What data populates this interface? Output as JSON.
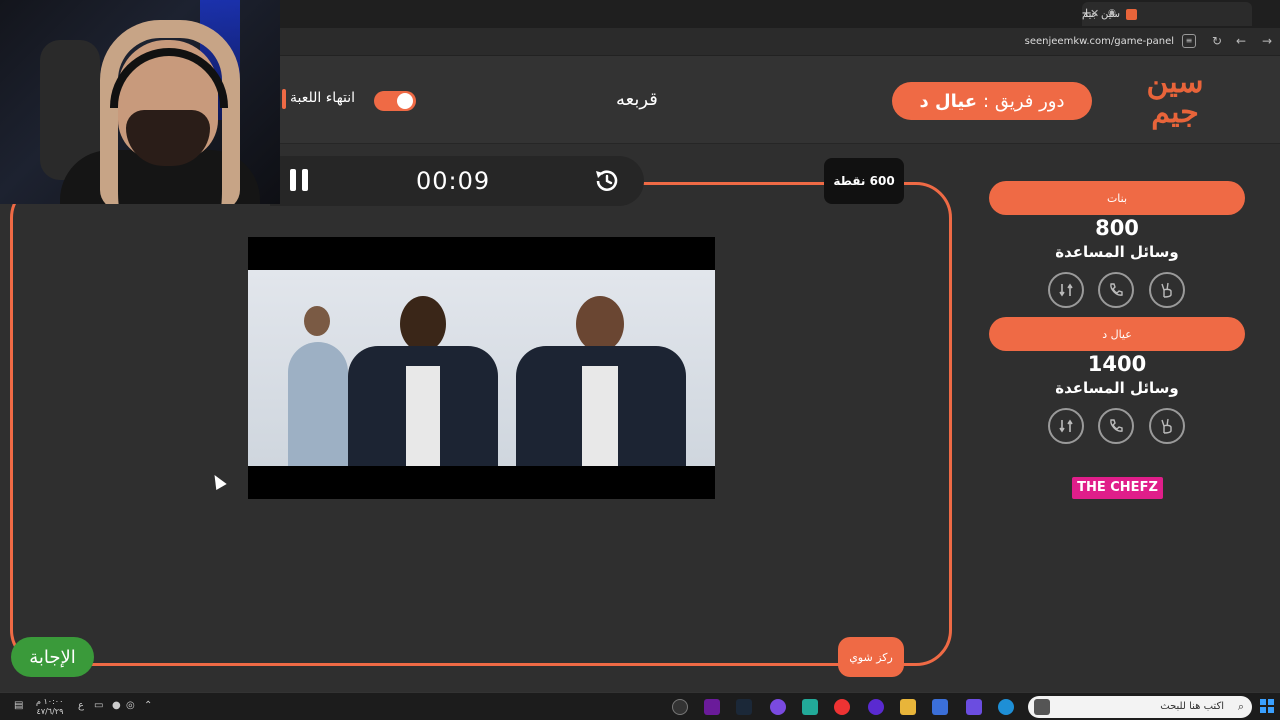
{
  "browser": {
    "tab_title": "سين جيم",
    "url": "seenjeemkw.com/game-panel",
    "new_tab_label": "+"
  },
  "header": {
    "logo_text": "سين جيم",
    "turn_label": "دور فريق :",
    "turn_team": "عيال د",
    "category": "قربعه",
    "end_game_label": "انتهاء اللعبة"
  },
  "question": {
    "timer": "00:09",
    "points": "600 نقطة",
    "hint_label": "ركز شوي",
    "answer_label": "الإجابة"
  },
  "teams": [
    {
      "name": "بنات",
      "score": "800",
      "aids_label": "وسائل المساعدة"
    },
    {
      "name": "عيال د",
      "score": "1400",
      "aids_label": "وسائل المساعدة"
    }
  ],
  "sponsor": "THE CHEFZ",
  "taskbar": {
    "search_placeholder": "اكتب هنا للبحث",
    "time": "١٠:٠٠ م",
    "date": "٤٧/٦/٢٩",
    "lang": "ع"
  },
  "colors": {
    "accent": "#ef6a45",
    "answer_green": "#3a9a3a",
    "sponsor_pink": "#e01e8a"
  }
}
